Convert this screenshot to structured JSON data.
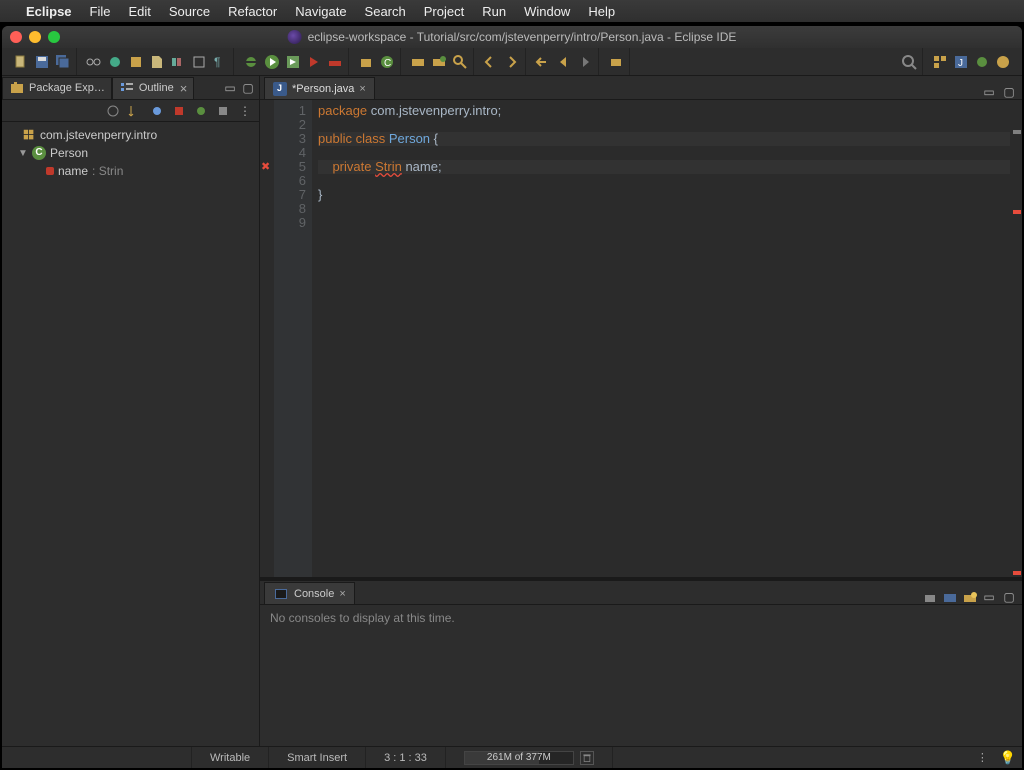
{
  "mac_menu": [
    "Eclipse",
    "File",
    "Edit",
    "Source",
    "Refactor",
    "Navigate",
    "Search",
    "Project",
    "Run",
    "Window",
    "Help"
  ],
  "window_title": "eclipse-workspace - Tutorial/src/com/jstevenperry/intro/Person.java - Eclipse IDE",
  "sidebar": {
    "tabs": [
      {
        "label": "Package Exp…",
        "icon": "package-explorer-icon",
        "closable": false
      },
      {
        "label": "Outline",
        "icon": "outline-icon",
        "closable": true,
        "active": true
      }
    ],
    "tree": {
      "package": "com.jstevenperry.intro",
      "class": "Person",
      "field_name": "name",
      "field_type": "Strin"
    }
  },
  "editor": {
    "tab_label": "*Person.java",
    "lines": [
      {
        "n": 1,
        "html": "<span class='kw'>package</span> com.jstevenperry.intro;"
      },
      {
        "n": 2,
        "html": ""
      },
      {
        "n": 3,
        "html": "<span class='kw'>public</span> <span class='kw'>class</span> <span class='cls'>Person</span> {"
      },
      {
        "n": 4,
        "html": ""
      },
      {
        "n": 5,
        "html": "    <span class='kw'>private</span> <span class='err'>Strin</span> name;"
      },
      {
        "n": 6,
        "html": ""
      },
      {
        "n": 7,
        "html": "}"
      },
      {
        "n": 8,
        "html": ""
      },
      {
        "n": 9,
        "html": ""
      }
    ]
  },
  "console": {
    "tab_label": "Console",
    "empty_msg": "No consoles to display at this time."
  },
  "status": {
    "writable": "Writable",
    "insert": "Smart Insert",
    "cursor": "3 : 1 : 33",
    "memory": "261M of 377M"
  }
}
